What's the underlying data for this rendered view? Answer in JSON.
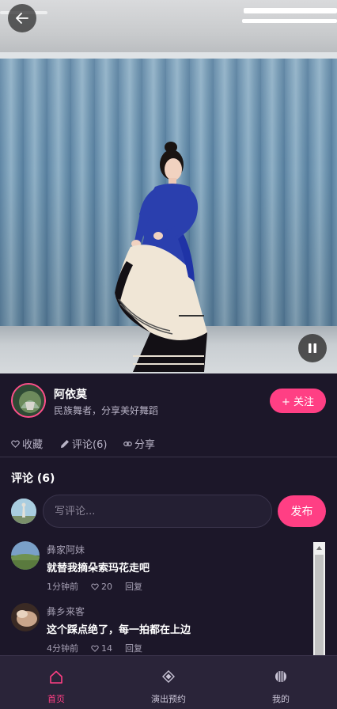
{
  "author": {
    "name": "阿依莫",
    "bio": "民族舞者，分享美好舞蹈",
    "follow_label": "+ 关注"
  },
  "actions": {
    "favorite_label": "收藏",
    "comment_label": "评论(6)",
    "share_label": "分享"
  },
  "comments": {
    "title": "评论 (6)",
    "input_placeholder": "写评论...",
    "publish_label": "发布",
    "items": [
      {
        "user": "彝家阿妹",
        "text": "就替我摘朵索玛花走吧",
        "time": "1分钟前",
        "likes": "20",
        "reply": "回复"
      },
      {
        "user": "彝乡来客",
        "text": "这个踩点绝了，每一拍都在上边",
        "time": "4分钟前",
        "likes": "14",
        "reply": "回复"
      }
    ]
  },
  "tabbar": {
    "items": [
      {
        "label": "首页",
        "icon": "home-icon",
        "active": true
      },
      {
        "label": "演出预约",
        "icon": "diamond-icon",
        "active": false
      },
      {
        "label": "我的",
        "icon": "globe-icon",
        "active": false
      }
    ]
  },
  "colors": {
    "accent": "#ff3f84",
    "background": "#1c1729",
    "tabbar": "#2a2439"
  }
}
